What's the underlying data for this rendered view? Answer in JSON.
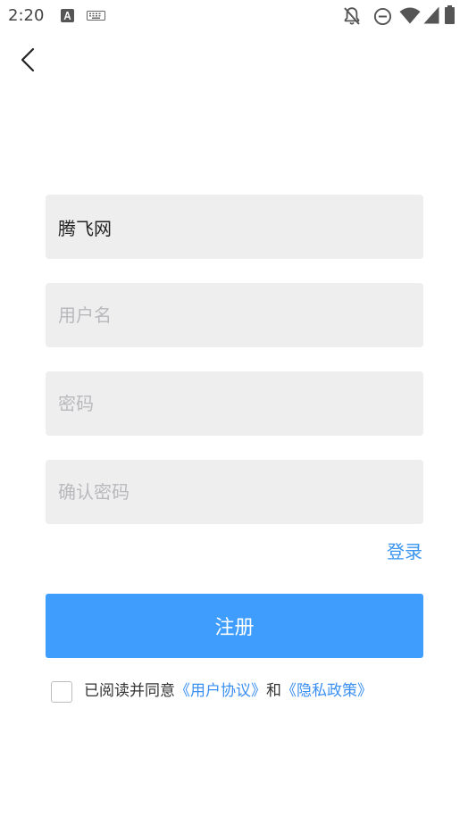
{
  "status_bar": {
    "time": "2:20",
    "left_icons": [
      "app-notification-icon",
      "keyboard-icon"
    ],
    "right_icons": [
      "notifications-off-icon",
      "do-not-disturb-icon",
      "wifi-icon",
      "cell-signal-icon",
      "battery-icon"
    ]
  },
  "nav": {
    "back_icon": "chevron-left-icon"
  },
  "form": {
    "site_field": {
      "value": "腾飞网"
    },
    "username_field": {
      "placeholder": "用户名"
    },
    "password_field": {
      "placeholder": "密码"
    },
    "confirm_password_field": {
      "placeholder": "确认密码"
    }
  },
  "login_link": {
    "label": "登录"
  },
  "register_button": {
    "label": "注册"
  },
  "agreement": {
    "checked": false,
    "prefix": "已阅读并同意",
    "terms_link": "《用户协议》",
    "conjunction": "和",
    "privacy_link": "《隐私政策》"
  },
  "colors": {
    "field_background": "#eeeeee",
    "primary": "#3e9dfd",
    "link": "#3a95f0",
    "text": "#333333",
    "placeholder": "#b9b9bd"
  }
}
